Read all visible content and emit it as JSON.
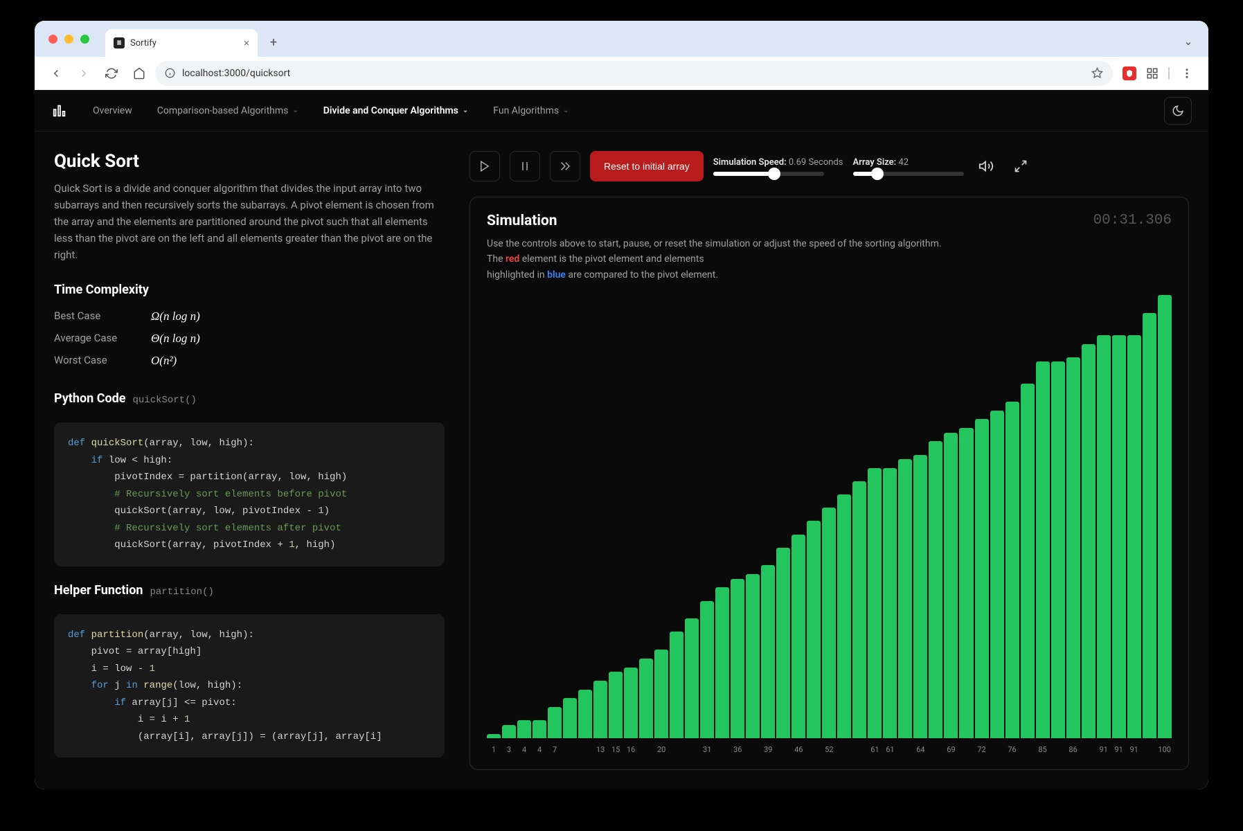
{
  "browser": {
    "tab_title": "Sortify",
    "url": "localhost:3000/quicksort"
  },
  "nav": {
    "items": [
      "Overview",
      "Comparison-based Algorithms",
      "Divide and Conquer Algorithms",
      "Fun Algorithms"
    ],
    "active_index": 2
  },
  "page": {
    "title": "Quick Sort",
    "description": "Quick Sort is a divide and conquer algorithm that divides the input array into two subarrays and then recursively sorts the subarrays. A pivot element is chosen from the array and the elements are partitioned around the pivot such that all elements less than the pivot are on the left and all elements greater than the pivot are on the right.",
    "time_complexity_title": "Time Complexity",
    "tc": [
      {
        "label": "Best Case",
        "value": "Ω(n log n)"
      },
      {
        "label": "Average Case",
        "value": "Θ(n log n)"
      },
      {
        "label": "Worst Case",
        "value": "O(n²)"
      }
    ],
    "code_title": "Python Code",
    "code_fn": "quickSort()",
    "helper_title": "Helper Function",
    "helper_fn": "partition()"
  },
  "controls": {
    "reset_label": "Reset to initial array",
    "speed_label": "Simulation Speed:",
    "speed_value": "0.69 Seconds",
    "speed_pct": 55,
    "size_label": "Array Size:",
    "size_value": "42",
    "size_pct": 22
  },
  "sim": {
    "title": "Simulation",
    "timer": "00:31.306",
    "desc_line1": "Use the controls above to start, pause, or reset the simulation or adjust the speed of the sorting algorithm.",
    "desc_red": "red",
    "desc_red_after": " element is the pivot element and elements",
    "desc_blue": "blue",
    "desc_blue_before": "highlighted in ",
    "desc_blue_after": " are compared to the pivot element.",
    "desc_the": "The "
  },
  "chart_data": {
    "type": "bar",
    "categories": [
      "1",
      "3",
      "4",
      "4",
      "7",
      "",
      "",
      "13",
      "15",
      "16",
      "",
      "20",
      "",
      "",
      "31",
      "",
      "36",
      "",
      "39",
      "",
      "46",
      "",
      "52",
      "",
      "",
      "61",
      "61",
      "",
      "64",
      "",
      "69",
      "",
      "72",
      "",
      "76",
      "",
      "85",
      "",
      "86",
      "",
      "91",
      "91",
      "91",
      "",
      "100"
    ],
    "values": [
      1,
      3,
      4,
      4,
      7,
      9,
      11,
      13,
      15,
      16,
      18,
      20,
      24,
      27,
      31,
      34,
      36,
      37,
      39,
      43,
      46,
      49,
      52,
      55,
      58,
      61,
      61,
      63,
      64,
      67,
      69,
      70,
      72,
      74,
      76,
      80,
      85,
      85,
      86,
      89,
      91,
      91,
      91,
      96,
      100
    ],
    "xlabel": "",
    "ylabel": "",
    "ylim": [
      0,
      100
    ]
  }
}
